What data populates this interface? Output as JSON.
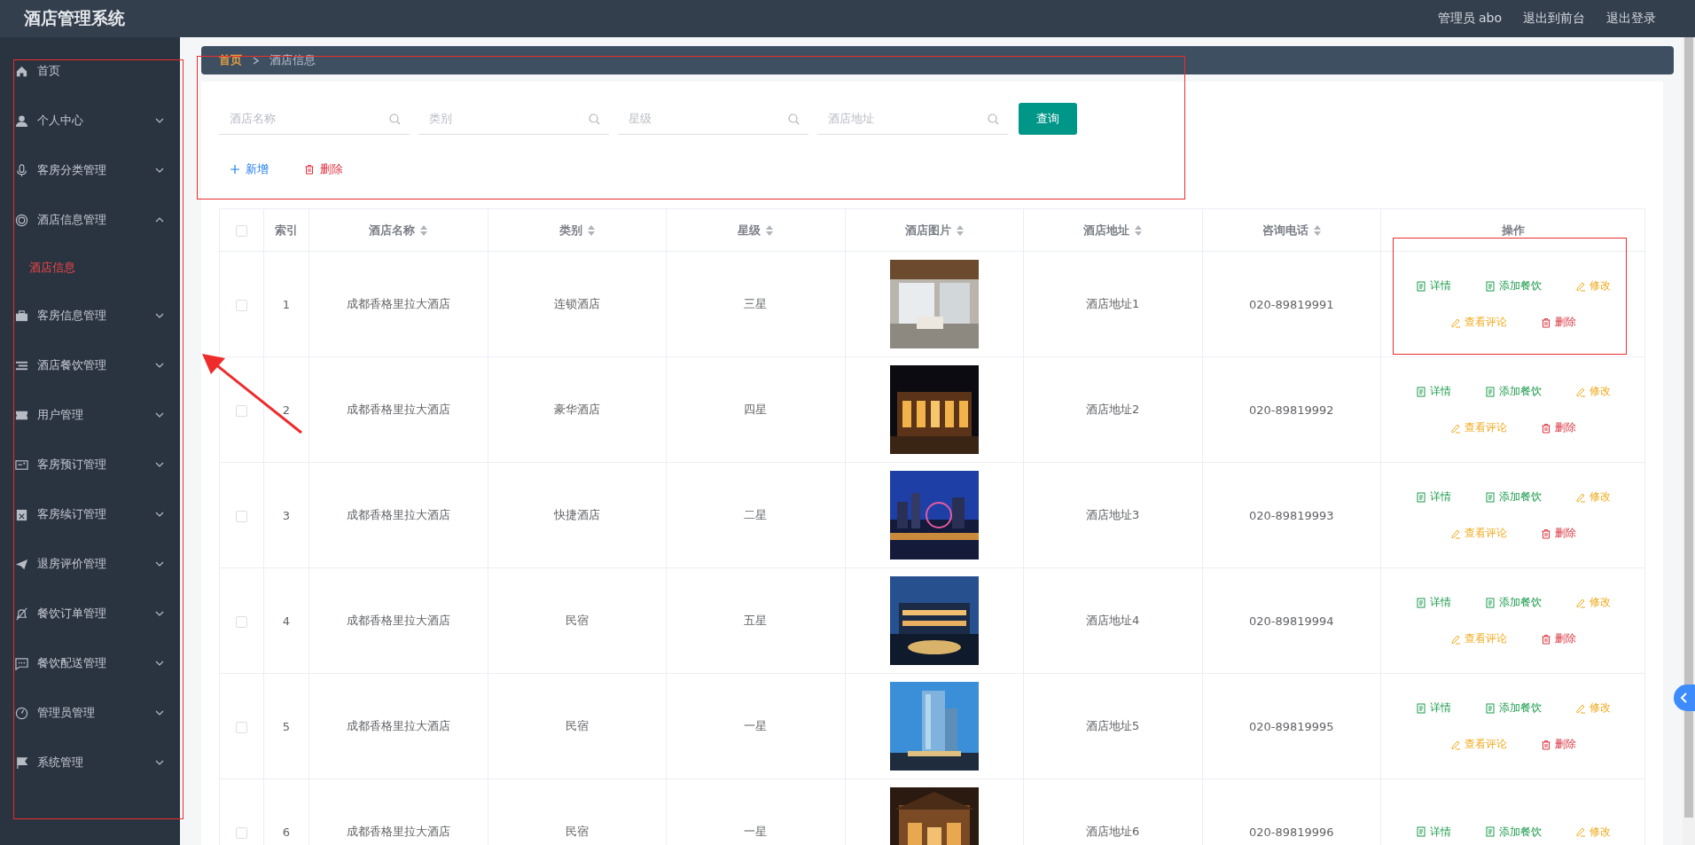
{
  "header": {
    "title": "酒店管理系统",
    "links": [
      "管理员 abo",
      "退出到前台",
      "退出登录"
    ]
  },
  "sidebar": {
    "items": [
      {
        "label": "首页",
        "kind": "link",
        "selected": false
      },
      {
        "label": "个人中心",
        "kind": "group",
        "expanded": false,
        "selected": false
      },
      {
        "label": "客房分类管理",
        "kind": "group",
        "expanded": false,
        "selected": false
      },
      {
        "label": "酒店信息管理",
        "kind": "group",
        "expanded": true,
        "selected": false,
        "children": [
          {
            "label": "酒店信息",
            "selected": true
          }
        ]
      },
      {
        "label": "客房信息管理",
        "kind": "group",
        "expanded": false,
        "selected": false
      },
      {
        "label": "酒店餐饮管理",
        "kind": "group",
        "expanded": false,
        "selected": false
      },
      {
        "label": "用户管理",
        "kind": "group",
        "expanded": false,
        "selected": false
      },
      {
        "label": "客房预订管理",
        "kind": "group",
        "expanded": false,
        "selected": false
      },
      {
        "label": "客房续订管理",
        "kind": "group",
        "expanded": false,
        "selected": false
      },
      {
        "label": "退房评价管理",
        "kind": "group",
        "expanded": false,
        "selected": false
      },
      {
        "label": "餐饮订单管理",
        "kind": "group",
        "expanded": false,
        "selected": false
      },
      {
        "label": "餐饮配送管理",
        "kind": "group",
        "expanded": false,
        "selected": false
      },
      {
        "label": "管理员管理",
        "kind": "group",
        "expanded": false,
        "selected": false
      },
      {
        "label": "系统管理",
        "kind": "group",
        "expanded": false,
        "selected": false
      }
    ]
  },
  "breadcrumb": [
    "首页",
    "酒店信息"
  ],
  "search": {
    "fields": [
      {
        "placeholder": "酒店名称"
      },
      {
        "placeholder": "类别"
      },
      {
        "placeholder": "星级"
      },
      {
        "placeholder": "酒店地址"
      }
    ],
    "button": "查询"
  },
  "toolbar": [
    {
      "label": "新增",
      "kind": "add"
    },
    {
      "label": "删除",
      "kind": "delete"
    }
  ],
  "table": {
    "select_all_checked": false,
    "columns": [
      {
        "label": "索引",
        "sortable": false
      },
      {
        "label": "酒店名称",
        "sortable": true
      },
      {
        "label": "类别",
        "sortable": true
      },
      {
        "label": "星级",
        "sortable": true
      },
      {
        "label": "酒店图片",
        "sortable": true
      },
      {
        "label": "酒店地址",
        "sortable": true
      },
      {
        "label": "咨询电话",
        "sortable": true
      },
      {
        "label": "操作",
        "sortable": false
      }
    ],
    "rows": [
      {
        "checked": false,
        "index": "1",
        "name": "成都香格里拉大酒店",
        "category": "连锁酒店",
        "stars": "三星",
        "image": {
          "kind": "picture"
        },
        "address": "酒店地址1",
        "phone": "020-89819991",
        "actions": [
          {
            "label": "详情",
            "kind": "info"
          },
          {
            "label": "添加餐饮",
            "kind": "info"
          },
          {
            "label": "修改",
            "kind": "edit"
          },
          {
            "label": "查看评论",
            "kind": "edit"
          },
          {
            "label": "删除",
            "kind": "danger"
          }
        ]
      },
      {
        "checked": false,
        "index": "2",
        "name": "成都香格里拉大酒店",
        "category": "豪华酒店",
        "stars": "四星",
        "image": {
          "kind": "picture"
        },
        "address": "酒店地址2",
        "phone": "020-89819992",
        "actions": [
          {
            "label": "详情",
            "kind": "info"
          },
          {
            "label": "添加餐饮",
            "kind": "info"
          },
          {
            "label": "修改",
            "kind": "edit"
          },
          {
            "label": "查看评论",
            "kind": "edit"
          },
          {
            "label": "删除",
            "kind": "danger"
          }
        ]
      },
      {
        "checked": false,
        "index": "3",
        "name": "成都香格里拉大酒店",
        "category": "快捷酒店",
        "stars": "二星",
        "image": {
          "kind": "picture"
        },
        "address": "酒店地址3",
        "phone": "020-89819993",
        "actions": [
          {
            "label": "详情",
            "kind": "info"
          },
          {
            "label": "添加餐饮",
            "kind": "info"
          },
          {
            "label": "修改",
            "kind": "edit"
          },
          {
            "label": "查看评论",
            "kind": "edit"
          },
          {
            "label": "删除",
            "kind": "danger"
          }
        ]
      },
      {
        "checked": false,
        "index": "4",
        "name": "成都香格里拉大酒店",
        "category": "民宿",
        "stars": "五星",
        "image": {
          "kind": "picture"
        },
        "address": "酒店地址4",
        "phone": "020-89819994",
        "actions": [
          {
            "label": "详情",
            "kind": "info"
          },
          {
            "label": "添加餐饮",
            "kind": "info"
          },
          {
            "label": "修改",
            "kind": "edit"
          },
          {
            "label": "查看评论",
            "kind": "edit"
          },
          {
            "label": "删除",
            "kind": "danger"
          }
        ]
      },
      {
        "checked": false,
        "index": "5",
        "name": "成都香格里拉大酒店",
        "category": "民宿",
        "stars": "一星",
        "image": {
          "kind": "picture"
        },
        "address": "酒店地址5",
        "phone": "020-89819995",
        "actions": [
          {
            "label": "详情",
            "kind": "info"
          },
          {
            "label": "添加餐饮",
            "kind": "info"
          },
          {
            "label": "修改",
            "kind": "edit"
          },
          {
            "label": "查看评论",
            "kind": "edit"
          },
          {
            "label": "删除",
            "kind": "danger"
          }
        ]
      },
      {
        "checked": false,
        "index": "6",
        "name": "成都香格里拉大酒店",
        "category": "民宿",
        "stars": "一星",
        "image": {
          "kind": "picture"
        },
        "address": "酒店地址6",
        "phone": "020-89819996",
        "actions": [
          {
            "label": "详情",
            "kind": "info"
          },
          {
            "label": "添加餐饮",
            "kind": "info"
          },
          {
            "label": "修改",
            "kind": "edit"
          }
        ]
      }
    ]
  }
}
